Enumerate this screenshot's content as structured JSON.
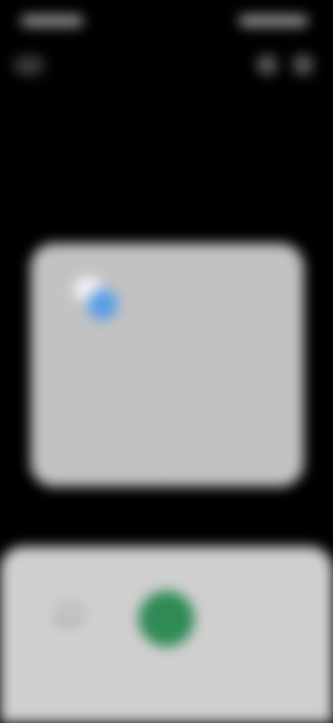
{
  "status_bar": {
    "time": "",
    "indicators": ""
  },
  "dialog": {
    "icon": "app-icon",
    "title": "",
    "message": "",
    "buttons": {
      "negative": "",
      "positive": ""
    }
  },
  "bottom_panel": {
    "gallery_icon": "gallery-icon",
    "shutter_icon": "shutter-icon"
  },
  "colors": {
    "background": "#000000",
    "dialog": "#c2c2c2",
    "panel": "#cfcfcf",
    "shutter": "#2f8a55",
    "icon_blue": "#5a9ee6"
  }
}
